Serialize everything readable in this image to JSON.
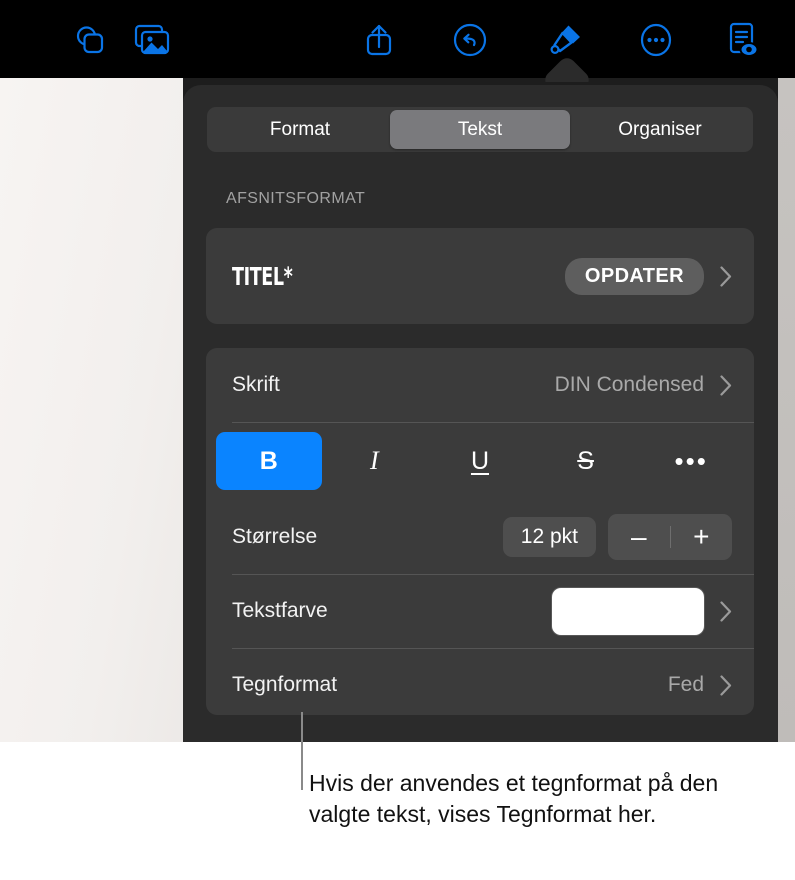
{
  "toolbar": {
    "icons": [
      {
        "name": "shapes-icon",
        "label": "Figurer"
      },
      {
        "name": "media-icon",
        "label": "Medier"
      },
      {
        "name": "share-icon",
        "label": "Del"
      },
      {
        "name": "undo-icon",
        "label": "Fortryd"
      },
      {
        "name": "format-brush-icon",
        "label": "Format"
      },
      {
        "name": "more-icon",
        "label": "Mere"
      },
      {
        "name": "document-view-icon",
        "label": "Dokument"
      }
    ],
    "accent_color": "#0a74e6",
    "background_color": "#000000"
  },
  "popover": {
    "tabs": [
      {
        "label": "Format",
        "selected": false
      },
      {
        "label": "Tekst",
        "selected": true
      },
      {
        "label": "Organiser",
        "selected": false
      }
    ],
    "section_header": "AFSNITSFORMAT",
    "paragraph_style": {
      "name": "TITEL*",
      "update_button": "OPDATER"
    },
    "rows": {
      "font": {
        "label": "Skrift",
        "value": "DIN Condensed"
      },
      "size": {
        "label": "Størrelse",
        "value": "12 pkt",
        "decrease": "–",
        "increase": "+"
      },
      "text_color": {
        "label": "Tekstfarve",
        "swatch_color": "#ffffff"
      },
      "character_style": {
        "label": "Tegnformat",
        "value": "Fed"
      }
    },
    "style_buttons": [
      {
        "name": "bold",
        "label": "B",
        "active": true
      },
      {
        "name": "italic",
        "label": "I",
        "active": false
      },
      {
        "name": "underline",
        "label": "U",
        "active": false
      },
      {
        "name": "strikethrough",
        "label": "S",
        "active": false
      },
      {
        "name": "more",
        "label": "•••",
        "active": false
      }
    ],
    "active_color": "#0a84ff",
    "background_color": "#2b2b2b"
  },
  "caption": {
    "text": "Hvis der anvendes et tegnformat på den valgte tekst, vises Tegnformat her."
  }
}
